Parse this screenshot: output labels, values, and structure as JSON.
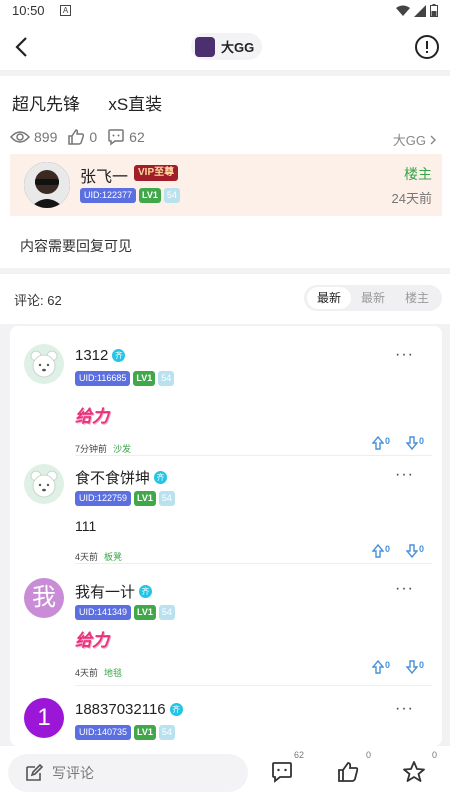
{
  "status_bar": {
    "time": "10:50",
    "notif": "A"
  },
  "header": {
    "app_name": "大GG"
  },
  "post": {
    "title": "超凡先锋      xS直装",
    "views": "899",
    "likes": "0",
    "comments": "62",
    "board": "大GG",
    "author": {
      "name": "张飞一",
      "vip": "VIP至尊",
      "uid": "UID:122377",
      "level": "LV1",
      "num": "54",
      "role": "楼主",
      "time": "24天前"
    },
    "content": "内容需要回复可见"
  },
  "comments_header": {
    "count_label": "评论: 62",
    "tabs": [
      "最新",
      "最新",
      "楼主"
    ]
  },
  "comments": [
    {
      "name": "1312",
      "qi": "齐",
      "uid": "UID:116685",
      "level": "LV1",
      "num": "54",
      "body": "给力",
      "time": "7分钟前",
      "floor": "沙发",
      "up": "0",
      "down": "0"
    },
    {
      "name": "食不食饼坤",
      "qi": "齐",
      "uid": "UID:122759",
      "level": "LV1",
      "num": "54",
      "body": "111",
      "time": "4天前",
      "floor": "板凳",
      "up": "0",
      "down": "0"
    },
    {
      "name": "我有一计",
      "qi": "齐",
      "uid": "UID:141349",
      "level": "LV1",
      "num": "54",
      "avatar_char": "我",
      "body": "给力",
      "time": "4天前",
      "floor": "地毯",
      "up": "0",
      "down": "0"
    },
    {
      "name": "18837032116",
      "qi": "齐",
      "uid": "UID:140735",
      "level": "LV1",
      "num": "54",
      "avatar_char": "1"
    }
  ],
  "more_glyph": "···",
  "bottom_bar": {
    "placeholder": "写评论",
    "comment_count": "62",
    "like_count": "0",
    "fav_count": "0"
  },
  "colors": {
    "accent_green": "#3aa34a",
    "uid_blue": "#5b6fe0",
    "vip_red": "#a11d2a",
    "author_bg": "#fdf0e9"
  }
}
